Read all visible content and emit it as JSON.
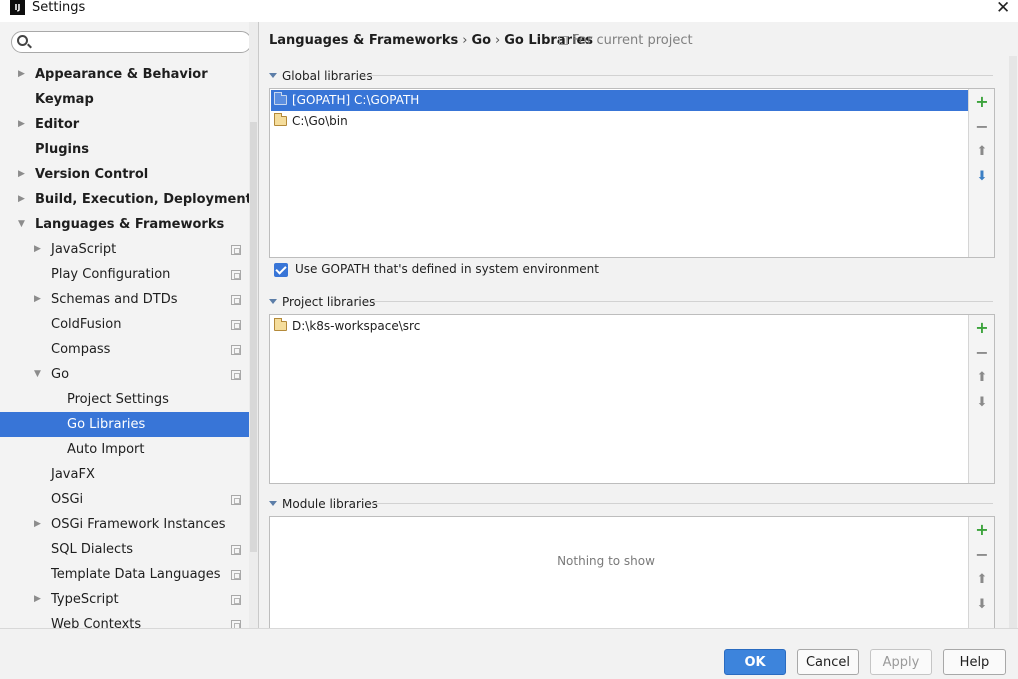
{
  "window": {
    "title": "Settings",
    "app_icon_text": "IJ"
  },
  "sidebar": {
    "search_placeholder": "",
    "items": [
      {
        "label": "Appearance & Behavior",
        "level": 0,
        "bold": true,
        "expander": "collapsed",
        "project_icon": false,
        "selected": false
      },
      {
        "label": "Keymap",
        "level": 0,
        "bold": true,
        "expander": "none",
        "project_icon": false,
        "selected": false
      },
      {
        "label": "Editor",
        "level": 0,
        "bold": true,
        "expander": "collapsed",
        "project_icon": false,
        "selected": false
      },
      {
        "label": "Plugins",
        "level": 0,
        "bold": true,
        "expander": "none",
        "project_icon": false,
        "selected": false
      },
      {
        "label": "Version Control",
        "level": 0,
        "bold": true,
        "expander": "collapsed",
        "project_icon": false,
        "selected": false
      },
      {
        "label": "Build, Execution, Deployment",
        "level": 0,
        "bold": true,
        "expander": "collapsed",
        "project_icon": false,
        "selected": false
      },
      {
        "label": "Languages & Frameworks",
        "level": 0,
        "bold": true,
        "expander": "expanded",
        "project_icon": false,
        "selected": false
      },
      {
        "label": "JavaScript",
        "level": 1,
        "bold": false,
        "expander": "collapsed",
        "project_icon": true,
        "selected": false
      },
      {
        "label": "Play Configuration",
        "level": 1,
        "bold": false,
        "expander": "none",
        "project_icon": true,
        "selected": false
      },
      {
        "label": "Schemas and DTDs",
        "level": 1,
        "bold": false,
        "expander": "collapsed",
        "project_icon": true,
        "selected": false
      },
      {
        "label": "ColdFusion",
        "level": 1,
        "bold": false,
        "expander": "none",
        "project_icon": true,
        "selected": false
      },
      {
        "label": "Compass",
        "level": 1,
        "bold": false,
        "expander": "none",
        "project_icon": true,
        "selected": false
      },
      {
        "label": "Go",
        "level": 1,
        "bold": false,
        "expander": "expanded",
        "project_icon": true,
        "selected": false
      },
      {
        "label": "Project Settings",
        "level": 2,
        "bold": false,
        "expander": "none",
        "project_icon": false,
        "selected": false
      },
      {
        "label": "Go Libraries",
        "level": 2,
        "bold": false,
        "expander": "none",
        "project_icon": false,
        "selected": true
      },
      {
        "label": "Auto Import",
        "level": 2,
        "bold": false,
        "expander": "none",
        "project_icon": false,
        "selected": false
      },
      {
        "label": "JavaFX",
        "level": 1,
        "bold": false,
        "expander": "none",
        "project_icon": false,
        "selected": false
      },
      {
        "label": "OSGi",
        "level": 1,
        "bold": false,
        "expander": "none",
        "project_icon": true,
        "selected": false
      },
      {
        "label": "OSGi Framework Instances",
        "level": 1,
        "bold": false,
        "expander": "collapsed",
        "project_icon": false,
        "selected": false
      },
      {
        "label": "SQL Dialects",
        "level": 1,
        "bold": false,
        "expander": "none",
        "project_icon": true,
        "selected": false
      },
      {
        "label": "Template Data Languages",
        "level": 1,
        "bold": false,
        "expander": "none",
        "project_icon": true,
        "selected": false
      },
      {
        "label": "TypeScript",
        "level": 1,
        "bold": false,
        "expander": "collapsed",
        "project_icon": true,
        "selected": false
      },
      {
        "label": "Web Contexts",
        "level": 1,
        "bold": false,
        "expander": "none",
        "project_icon": true,
        "selected": false
      }
    ]
  },
  "breadcrumb": {
    "parts": [
      "Languages & Frameworks",
      "Go",
      "Go Libraries"
    ],
    "separator": "›",
    "scope_note": "For current project"
  },
  "global_libraries": {
    "header": "Global libraries",
    "items": [
      {
        "text": "[GOPATH] C:\\GOPATH",
        "selected": true
      },
      {
        "text": "C:\\Go\\bin",
        "selected": false
      }
    ]
  },
  "use_gopath": {
    "label": "Use GOPATH that's defined in system environment",
    "checked": true
  },
  "project_libraries": {
    "header": "Project libraries",
    "items": [
      {
        "text": "D:\\k8s-workspace\\src",
        "selected": false
      }
    ]
  },
  "module_libraries": {
    "header": "Module libraries",
    "empty_text": "Nothing to show"
  },
  "toolbar_icons": {
    "add": "+",
    "remove": "−",
    "up": "⬆",
    "down": "⬇"
  },
  "buttons": {
    "ok": "OK",
    "cancel": "Cancel",
    "apply": "Apply",
    "help": "Help"
  },
  "colors": {
    "selection": "#3875d7",
    "ok_button": "#3d84dc",
    "add_icon": "#3ca33c"
  }
}
